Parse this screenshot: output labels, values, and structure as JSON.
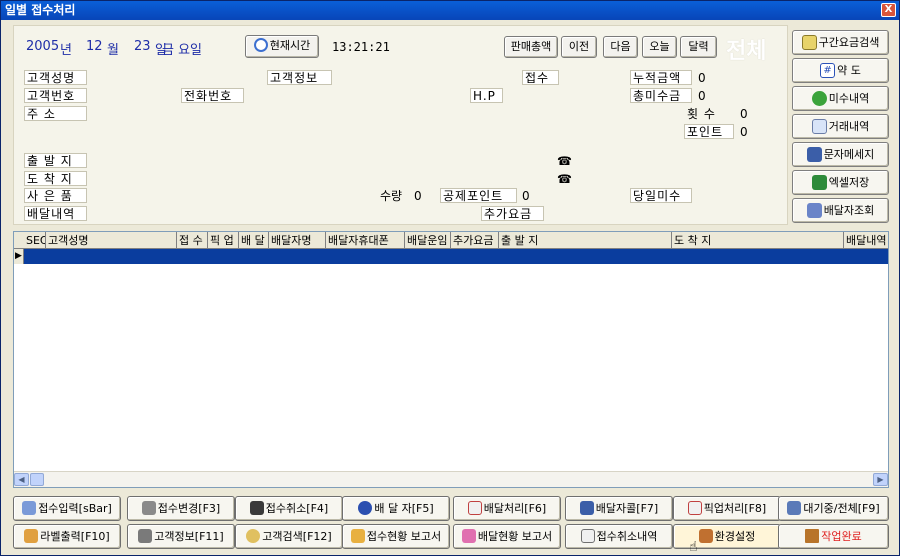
{
  "window": {
    "title": "일별 접수처리",
    "close": "X"
  },
  "date": {
    "year": "2005",
    "year_unit": "년",
    "month": "12",
    "month_unit": "월",
    "day": "23",
    "day_unit": "일",
    "weekday": "금 요일"
  },
  "clock": {
    "button": "현재시간",
    "time": "13:21:21"
  },
  "nav_buttons": [
    "판매총액",
    "이전",
    "다음",
    "오늘",
    "달력"
  ],
  "filter_label": "전체",
  "fields": {
    "customer_name": "고객성명",
    "customer_info": "고객정보",
    "received": "접수",
    "total_amount": "누적금액",
    "total_amount_value": "0",
    "customer_no": "고객번호",
    "phone": "전화번호",
    "hp": "H.P",
    "total_unpaid": "총미수금",
    "total_unpaid_value": "0",
    "address": "주       소",
    "count": "횟   수",
    "count_value": "0",
    "points": "포인트",
    "points_value": "0",
    "origin": "출 발 지",
    "origin_tel": "☎",
    "destination": "도 착 지",
    "destination_tel": "☎",
    "goods": "사 은 품",
    "quantity": "수량",
    "quantity_value": "0",
    "deduct_points": "공제포인트",
    "deduct_points_value": "0",
    "today_unpaid": "당일미수",
    "delivery_detail": "배달내역",
    "extra_fee": "추가요금"
  },
  "side_buttons": [
    {
      "label": "구간요금검색",
      "icon": "search-fare-icon"
    },
    {
      "label": "약 도",
      "icon": "map-icon"
    },
    {
      "label": "미수내역",
      "icon": "money-bag-icon"
    },
    {
      "label": "거래내역",
      "icon": "ledger-icon"
    },
    {
      "label": "문자메세지",
      "icon": "message-icon"
    },
    {
      "label": "엑셀저장",
      "icon": "excel-icon"
    },
    {
      "label": "배달자조회",
      "icon": "people-icon"
    }
  ],
  "grid": {
    "columns": [
      "SEQ",
      "고객성명",
      "접 수",
      "픽 업",
      "배 달",
      "배달자명",
      "배달자휴대폰",
      "배달운임",
      "추가요금",
      "출 발 지",
      "도 착 지",
      "배달내역"
    ],
    "row_indicator": "▶"
  },
  "bottom_buttons_row1": [
    {
      "label": "접수입력[sBar]",
      "icon": "form-icon"
    },
    {
      "label": "접수변경[F3]",
      "icon": "edit-icon"
    },
    {
      "label": "접수취소[F4]",
      "icon": "disk-icon"
    },
    {
      "label": "배 달 자[F5]",
      "icon": "person-icon"
    },
    {
      "label": "배달처리[F6]",
      "icon": "delivery-doc-icon"
    },
    {
      "label": "배달자콜[F7]",
      "icon": "call-icon"
    },
    {
      "label": "픽업처리[F8]",
      "icon": "pickup-doc-icon"
    },
    {
      "label": "대기중/전체[F9]",
      "icon": "list-icon"
    }
  ],
  "bottom_buttons_row2": [
    {
      "label": "라벨출력[F10]",
      "icon": "printer-icon"
    },
    {
      "label": "고객정보[F11]",
      "icon": "customer-card-icon"
    },
    {
      "label": "고객검색[F12]",
      "icon": "customer-search-icon"
    },
    {
      "label": "접수현황 보고서",
      "icon": "report-icon"
    },
    {
      "label": "배달현황 보고서",
      "icon": "report-pink-icon"
    },
    {
      "label": "접수취소내역",
      "icon": "cancel-list-icon"
    },
    {
      "label": "환경설정",
      "icon": "settings-icon"
    },
    {
      "label": "작업완료",
      "icon": "door-icon"
    }
  ]
}
